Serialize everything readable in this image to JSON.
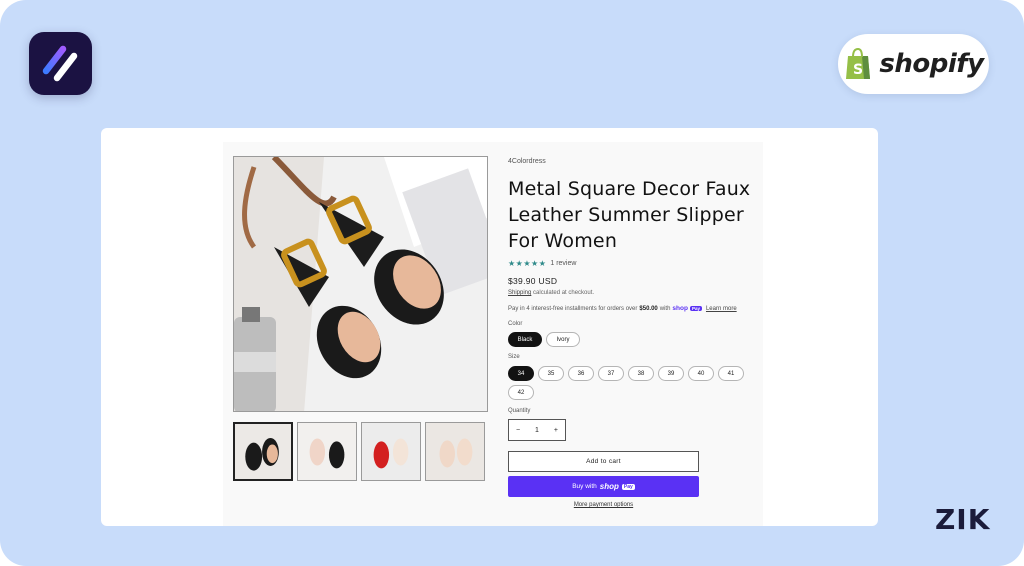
{
  "branding": {
    "shopify_text": "shopify",
    "watermark": "ZIK",
    "colors": {
      "background": "#c8dcfa",
      "app_logo_bg": "#1b1242",
      "shopify_green": "#95bf47",
      "shop_pay_purple": "#5a31f4"
    }
  },
  "product": {
    "vendor": "4Colordress",
    "title": "Metal Square Decor Faux Leather Summer Slipper For Women",
    "rating": {
      "stars": "★★★★★",
      "review_count": "1 review"
    },
    "price": "$39.90 USD",
    "shipping": {
      "link": "Shipping",
      "text": " calculated at checkout."
    },
    "installments": {
      "prefix": "Pay in 4 interest-free installments for orders over",
      "amount": "$50.00",
      "with": "with",
      "shop_word": "shop",
      "pay_word": "Pay",
      "learn_more": "Learn more"
    },
    "color": {
      "label": "Color",
      "options": [
        "Black",
        "Ivory"
      ],
      "selected": "Black"
    },
    "size": {
      "label": "Size",
      "options": [
        "34",
        "35",
        "36",
        "37",
        "38",
        "39",
        "40",
        "41",
        "42"
      ],
      "selected": "34"
    },
    "quantity": {
      "label": "Quantity",
      "value": "1",
      "minus": "−",
      "plus": "+"
    },
    "add_to_cart": "Add to cart",
    "buy_now": {
      "prefix": "Buy with",
      "shop": "shop",
      "pay": "Pay"
    },
    "more_payment_options": "More payment options"
  }
}
